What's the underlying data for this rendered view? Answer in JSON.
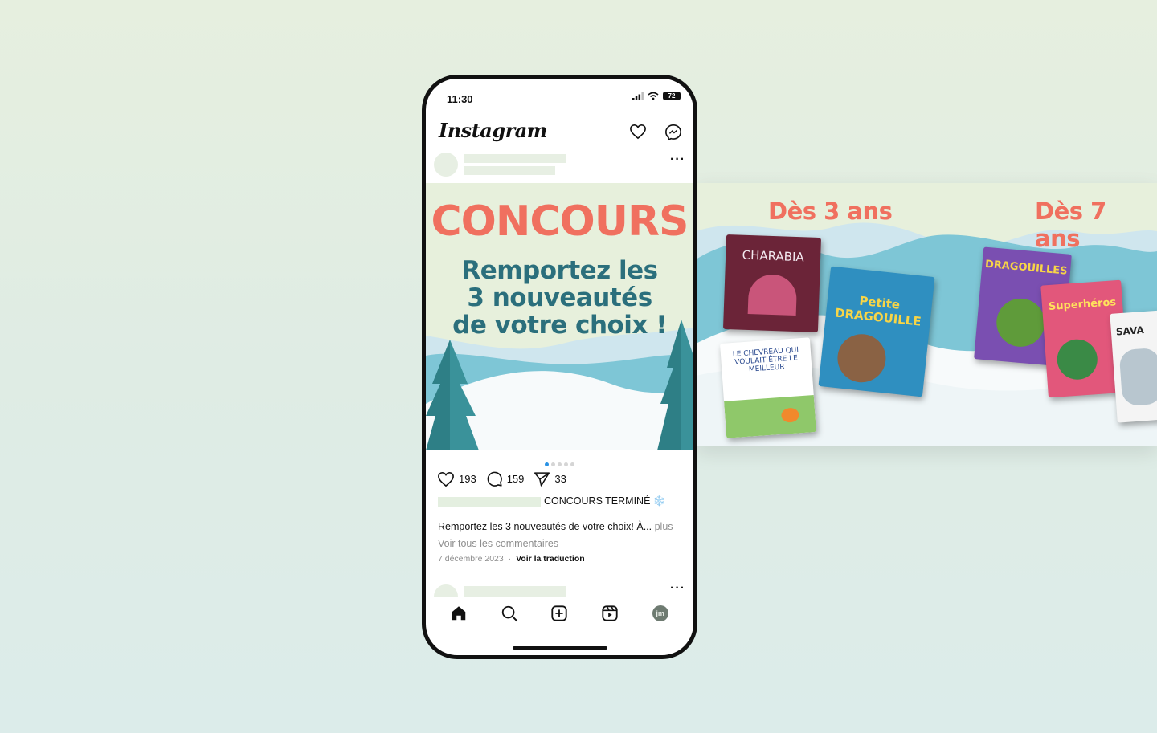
{
  "banner": {
    "age_left": "Dès 3 ans",
    "age_right": "Dès 7 ans",
    "books": [
      {
        "title": "CHARABIA",
        "color": "#6b2438"
      },
      {
        "title": "LE CHEVREAU QUI VOULAIT ÊTRE LE MEILLEUR",
        "color": "#ffffff"
      },
      {
        "title": "Petite DRAGOUILLE",
        "color": "#2f8fc0"
      },
      {
        "title": "DRAGOUILLES",
        "color": "#7a4fb1"
      },
      {
        "title": "Superhéros",
        "color": "#e2577b"
      },
      {
        "title": "SAVA",
        "color": "#f4f4f4"
      }
    ]
  },
  "phone": {
    "status": {
      "time": "11:30",
      "battery": "72"
    },
    "header": {
      "logo": "Instagram"
    },
    "post": {
      "image": {
        "headline": "CONCOURS",
        "line1": "Remportez les",
        "line2": "3 nouveautés",
        "line3": "de votre choix !"
      },
      "carousel": {
        "count": 5,
        "active": 0
      },
      "likes": "193",
      "comments_count": "159",
      "shares": "33",
      "caption_tag": "CONCOURS TERMINÉ ❄️",
      "caption_text": "Remportez les 3 nouveautés de votre choix! À...",
      "caption_more": "plus",
      "view_comments": "Voir tous les commentaires",
      "date": "7 décembre 2023",
      "separator": "·",
      "translate": "Voir la traduction"
    },
    "tabbar": {
      "avatar_initials": "jm"
    }
  },
  "colors": {
    "accent_coral": "#f0705f",
    "accent_teal": "#2b6f7c",
    "carousel_active": "#2a92e4"
  }
}
